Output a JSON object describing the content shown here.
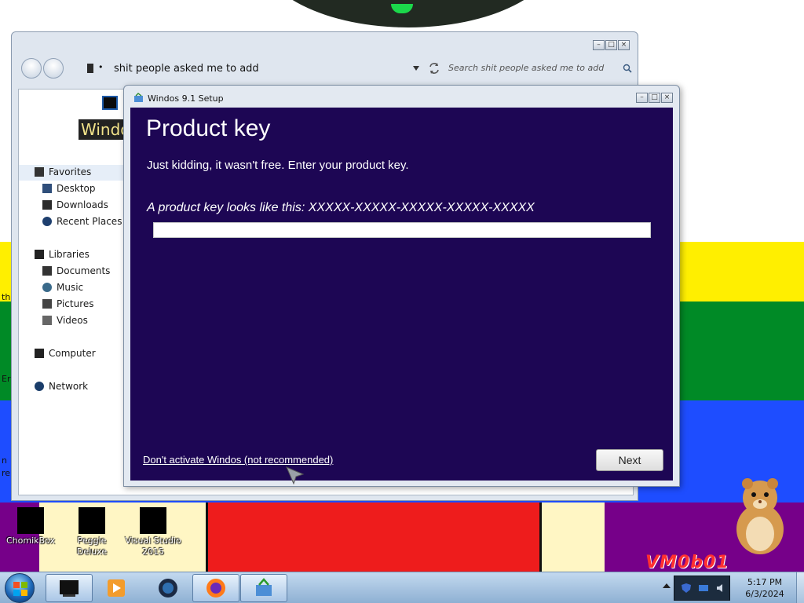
{
  "explorer": {
    "address": "shit people asked me to add",
    "search_placeholder": "Search shit people asked me to add",
    "partial_label": "Windo",
    "nav": {
      "favorites": "Favorites",
      "desktop": "Desktop",
      "downloads": "Downloads",
      "recent": "Recent Places",
      "libraries": "Libraries",
      "documents": "Documents",
      "music": "Music",
      "pictures": "Pictures",
      "videos": "Videos",
      "computer": "Computer",
      "network": "Network"
    }
  },
  "setup": {
    "window_title": "Windos 9.1 Setup",
    "heading": "Product key",
    "subtitle": "Just kidding, it wasn't free. Enter your product key.",
    "example": "A product key looks like this: XXXXX-XXXXX-XXXXX-XXXXX-XXXXX",
    "input_value": "",
    "skip_link": "Don't activate Windos (not recommended)",
    "next_label": "Next",
    "colors": {
      "body_bg": "#1d0654"
    }
  },
  "desktop": {
    "edge_texts": [
      "th",
      "Er",
      "n",
      "re"
    ],
    "icons": [
      {
        "label": "ChomikBox"
      },
      {
        "label": "Peggle Deluxe"
      },
      {
        "label": "Visual Studio 2015"
      }
    ],
    "logo_text": "VM0b01"
  },
  "taskbar": {
    "items": [
      "terminal-icon",
      "media-player-icon",
      "globe-icon",
      "firefox-icon",
      "setup-icon"
    ],
    "time": "5:17 PM",
    "date": "6/3/2024"
  }
}
